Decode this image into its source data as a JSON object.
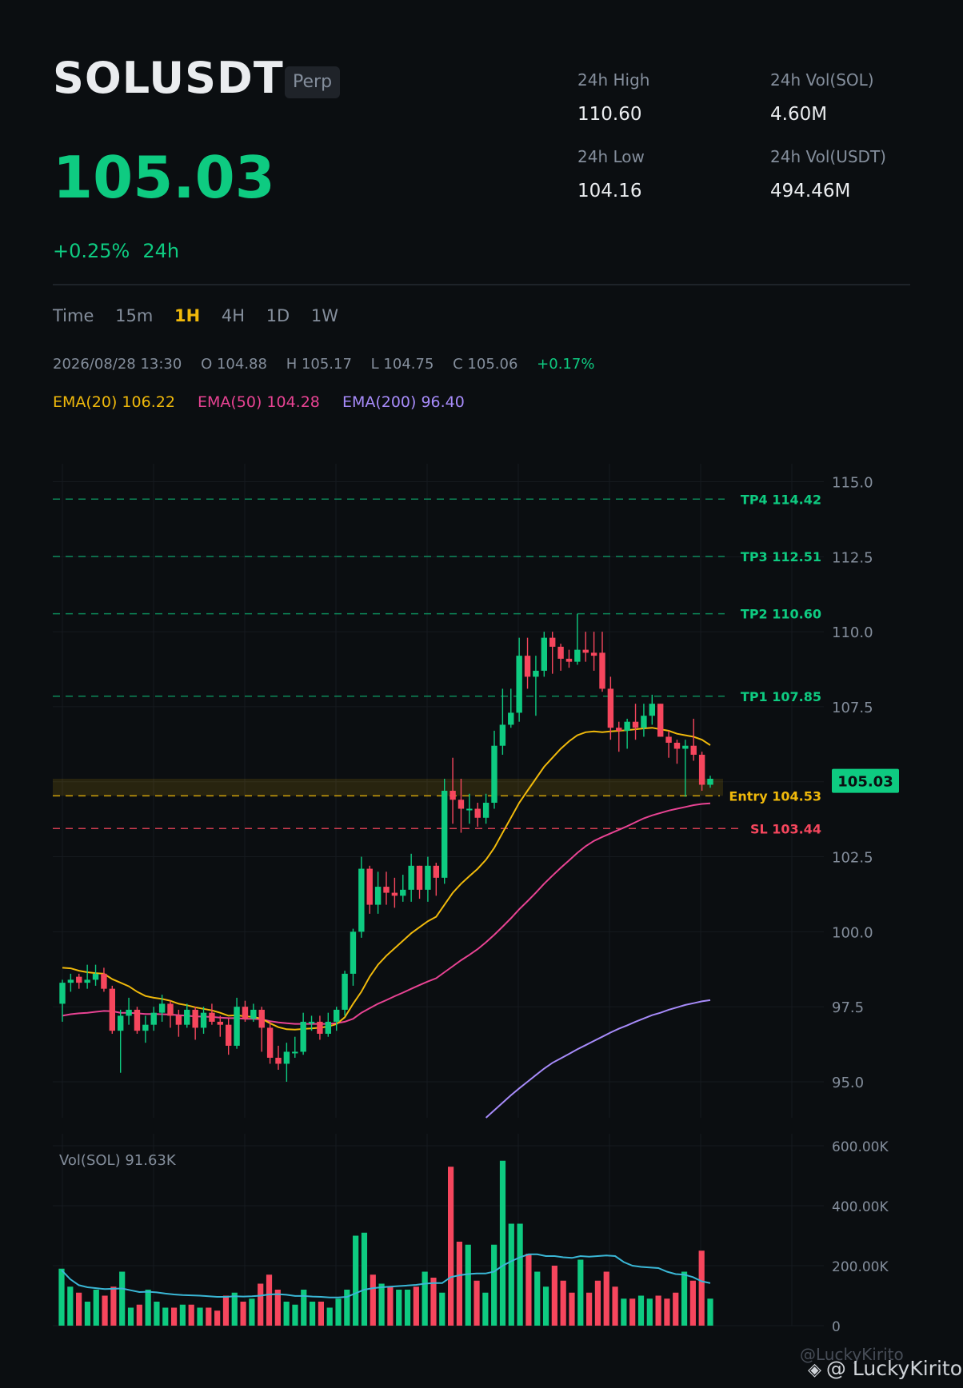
{
  "header": {
    "symbol": "SOLUSDT",
    "badge": "Perp",
    "price": "105.03",
    "change_pct": "+0.25%",
    "change_period": "24h"
  },
  "stats": {
    "high_label": "24h High",
    "high_value": "110.60",
    "low_label": "24h Low",
    "low_value": "104.16",
    "vol_base_label": "24h Vol(SOL)",
    "vol_base_value": "4.60M",
    "vol_quote_label": "24h Vol(USDT)",
    "vol_quote_value": "494.46M"
  },
  "timeframes": {
    "label": "Time",
    "options": [
      "15m",
      "1H",
      "4H",
      "1D",
      "1W"
    ],
    "selected": "1H"
  },
  "ohlc": {
    "datetime": "2026/08/28 13:30",
    "open": "O 104.88",
    "high": "H 105.17",
    "low": "L 104.75",
    "close": "C 105.06",
    "change": "+0.17%"
  },
  "indicators": {
    "ema20": "EMA(20) 106.22",
    "ema50": "EMA(50) 104.28",
    "ema200": "EMA(200) 96.40"
  },
  "colors": {
    "up": "#0ecb81",
    "down": "#f6465d",
    "ema20": "#f0b90b",
    "ema50": "#e84393",
    "ema200": "#a78bfa",
    "vol_ma": "#3ab7d6",
    "entry": "#f0b90b",
    "sl": "#f6465d",
    "tp": "#0ecb81"
  },
  "chart_data": {
    "type": "candlestick",
    "price_axis": {
      "ylim": [
        93.8,
        115.6
      ],
      "ticks": [
        "115.0",
        "112.5",
        "110.0",
        "107.5",
        "105.0",
        "102.5",
        "100.0",
        "97.5",
        "95.0"
      ],
      "tick_values": [
        115,
        112.5,
        110,
        107.5,
        105,
        102.5,
        100,
        97.5,
        95
      ]
    },
    "current_price_label": "105.03",
    "current_price": 105.03,
    "levels": [
      {
        "label": "TP4 114.42",
        "value": 114.42,
        "kind": "tp"
      },
      {
        "label": "TP3 112.51",
        "value": 112.51,
        "kind": "tp"
      },
      {
        "label": "TP2 110.60",
        "value": 110.6,
        "kind": "tp"
      },
      {
        "label": "TP1 107.85",
        "value": 107.85,
        "kind": "tp"
      },
      {
        "label": "Entry 104.53",
        "value": 104.53,
        "kind": "entry"
      },
      {
        "label": "SL 103.44",
        "value": 103.44,
        "kind": "sl"
      }
    ],
    "entry_zone": [
      104.53,
      105.1
    ],
    "candles": [
      [
        97.6,
        98.3,
        97.0,
        98.4
      ],
      [
        98.3,
        98.4,
        98.0,
        98.6
      ],
      [
        98.5,
        98.3,
        98.1,
        98.6
      ],
      [
        98.3,
        98.4,
        98.1,
        98.9
      ],
      [
        98.4,
        98.6,
        98.2,
        98.9
      ],
      [
        98.6,
        98.1,
        98.0,
        98.8
      ],
      [
        98.1,
        96.7,
        96.6,
        98.2
      ],
      [
        96.7,
        97.2,
        95.3,
        97.4
      ],
      [
        97.2,
        97.4,
        96.9,
        97.8
      ],
      [
        97.4,
        96.7,
        96.6,
        97.5
      ],
      [
        96.7,
        96.9,
        96.3,
        97.2
      ],
      [
        96.9,
        97.3,
        96.7,
        97.5
      ],
      [
        97.3,
        97.6,
        97.0,
        97.9
      ],
      [
        97.6,
        97.2,
        96.8,
        97.7
      ],
      [
        97.2,
        96.9,
        96.5,
        97.4
      ],
      [
        96.9,
        97.4,
        96.8,
        97.6
      ],
      [
        97.4,
        96.8,
        96.4,
        97.5
      ],
      [
        96.8,
        97.3,
        96.6,
        97.5
      ],
      [
        97.3,
        97.0,
        96.9,
        97.6
      ],
      [
        97.0,
        96.9,
        96.5,
        97.2
      ],
      [
        96.9,
        96.2,
        95.9,
        97.1
      ],
      [
        96.2,
        97.5,
        96.1,
        97.8
      ],
      [
        97.5,
        97.1,
        97.0,
        97.7
      ],
      [
        97.1,
        97.4,
        97.0,
        97.6
      ],
      [
        97.4,
        96.8,
        96.0,
        97.5
      ],
      [
        96.8,
        95.8,
        95.6,
        97.0
      ],
      [
        95.8,
        95.6,
        95.4,
        96.2
      ],
      [
        95.6,
        96.0,
        95.0,
        96.3
      ],
      [
        96.0,
        96.0,
        95.8,
        96.5
      ],
      [
        96.0,
        97.0,
        95.9,
        97.3
      ],
      [
        97.0,
        97.0,
        96.7,
        97.2
      ],
      [
        97.0,
        96.6,
        96.4,
        97.2
      ],
      [
        96.6,
        97.0,
        96.5,
        97.3
      ],
      [
        97.0,
        97.4,
        96.7,
        97.5
      ],
      [
        97.4,
        98.6,
        97.2,
        98.7
      ],
      [
        98.6,
        100.0,
        98.2,
        100.1
      ],
      [
        100.0,
        102.1,
        99.8,
        102.5
      ],
      [
        102.1,
        100.9,
        100.6,
        102.2
      ],
      [
        100.9,
        101.5,
        100.6,
        102.0
      ],
      [
        101.5,
        101.3,
        100.9,
        102.0
      ],
      [
        101.3,
        101.2,
        100.8,
        101.8
      ],
      [
        101.2,
        101.4,
        101.0,
        101.9
      ],
      [
        101.4,
        102.2,
        101.0,
        102.6
      ],
      [
        102.2,
        101.4,
        101.1,
        102.2
      ],
      [
        101.4,
        102.2,
        101.0,
        102.5
      ],
      [
        102.2,
        101.8,
        101.2,
        102.3
      ],
      [
        101.8,
        104.7,
        101.6,
        105.1
      ],
      [
        104.7,
        104.4,
        103.6,
        105.8
      ],
      [
        104.4,
        104.1,
        103.3,
        105.1
      ],
      [
        104.1,
        104.1,
        103.6,
        104.6
      ],
      [
        104.1,
        103.8,
        103.5,
        104.3
      ],
      [
        103.8,
        104.3,
        103.6,
        104.6
      ],
      [
        104.3,
        106.2,
        104.1,
        106.7
      ],
      [
        106.2,
        106.9,
        105.9,
        108.1
      ],
      [
        106.9,
        107.3,
        106.8,
        108.1
      ],
      [
        107.3,
        109.2,
        107.0,
        109.8
      ],
      [
        109.2,
        108.5,
        108.1,
        109.8
      ],
      [
        108.5,
        108.7,
        107.2,
        109.2
      ],
      [
        108.7,
        109.8,
        108.5,
        110.0
      ],
      [
        109.8,
        109.5,
        108.6,
        110.0
      ],
      [
        109.5,
        109.1,
        108.7,
        109.6
      ],
      [
        109.1,
        109.0,
        108.8,
        109.4
      ],
      [
        109.0,
        109.4,
        108.9,
        110.6
      ],
      [
        109.4,
        109.3,
        109.0,
        110.0
      ],
      [
        109.3,
        109.2,
        108.7,
        110.0
      ],
      [
        109.3,
        108.1,
        108.0,
        110.0
      ],
      [
        108.1,
        106.8,
        106.4,
        108.5
      ],
      [
        106.8,
        106.7,
        106.0,
        107.0
      ],
      [
        106.7,
        107.0,
        106.1,
        107.1
      ],
      [
        107.0,
        106.8,
        106.4,
        107.6
      ],
      [
        106.8,
        107.2,
        106.5,
        107.6
      ],
      [
        107.2,
        107.6,
        106.9,
        107.9
      ],
      [
        107.6,
        106.5,
        106.5,
        107.6
      ],
      [
        106.5,
        106.3,
        105.8,
        106.7
      ],
      [
        106.3,
        106.1,
        105.6,
        106.4
      ],
      [
        106.1,
        106.2,
        104.5,
        106.4
      ],
      [
        106.2,
        105.9,
        105.7,
        107.1
      ],
      [
        105.9,
        104.9,
        104.7,
        106.0
      ],
      [
        104.9,
        105.1,
        104.8,
        105.2
      ]
    ],
    "ema20": [
      98.8,
      98.78,
      98.7,
      98.65,
      98.62,
      98.6,
      98.42,
      98.3,
      98.18,
      98.0,
      97.86,
      97.8,
      97.76,
      97.7,
      97.6,
      97.55,
      97.48,
      97.43,
      97.38,
      97.3,
      97.2,
      97.22,
      97.18,
      97.16,
      97.1,
      96.95,
      96.82,
      96.75,
      96.74,
      96.76,
      96.78,
      96.8,
      96.84,
      96.92,
      97.15,
      97.6,
      98.0,
      98.5,
      98.9,
      99.2,
      99.45,
      99.7,
      99.95,
      100.15,
      100.35,
      100.5,
      100.9,
      101.3,
      101.6,
      101.85,
      102.1,
      102.4,
      102.8,
      103.3,
      103.8,
      104.3,
      104.7,
      105.1,
      105.5,
      105.8,
      106.1,
      106.35,
      106.55,
      106.65,
      106.68,
      106.65,
      106.68,
      106.7,
      106.72,
      106.75,
      106.78,
      106.8,
      106.75,
      106.7,
      106.6,
      106.55,
      106.5,
      106.4,
      106.22
    ],
    "ema50": [
      97.2,
      97.25,
      97.28,
      97.3,
      97.33,
      97.36,
      97.35,
      97.3,
      97.3,
      97.28,
      97.26,
      97.26,
      97.25,
      97.24,
      97.22,
      97.2,
      97.18,
      97.17,
      97.16,
      97.14,
      97.12,
      97.12,
      97.1,
      97.1,
      97.08,
      97.02,
      96.98,
      96.95,
      96.93,
      96.93,
      96.93,
      96.93,
      96.93,
      96.95,
      97.0,
      97.1,
      97.3,
      97.45,
      97.6,
      97.72,
      97.85,
      97.97,
      98.1,
      98.22,
      98.34,
      98.45,
      98.65,
      98.85,
      99.05,
      99.23,
      99.42,
      99.65,
      99.9,
      100.17,
      100.45,
      100.75,
      101.02,
      101.3,
      101.6,
      101.87,
      102.13,
      102.38,
      102.63,
      102.85,
      103.03,
      103.16,
      103.28,
      103.4,
      103.52,
      103.65,
      103.78,
      103.88,
      103.96,
      104.04,
      104.1,
      104.16,
      104.22,
      104.26,
      104.28
    ],
    "ema200_start_index": 51,
    "ema200": [
      93.8,
      94.05,
      94.3,
      94.55,
      94.78,
      95.0,
      95.22,
      95.44,
      95.63,
      95.78,
      95.93,
      96.08,
      96.22,
      96.36,
      96.5,
      96.64,
      96.77,
      96.88,
      97.0,
      97.11,
      97.22,
      97.3,
      97.4,
      97.48,
      97.56,
      97.62,
      97.68,
      97.72
    ],
    "volume": {
      "label": "Vol(SOL) 91.63K",
      "ylim": [
        0,
        640000
      ],
      "ticks": [
        "600.00K",
        "400.00K",
        "200.00K",
        "0"
      ],
      "tick_values": [
        600000,
        400000,
        200000,
        0
      ],
      "values": [
        190000,
        130000,
        110000,
        80000,
        120000,
        100000,
        130000,
        180000,
        60000,
        70000,
        120000,
        80000,
        60000,
        60000,
        70000,
        70000,
        60000,
        60000,
        50000,
        100000,
        110000,
        80000,
        90000,
        140000,
        170000,
        120000,
        80000,
        70000,
        120000,
        80000,
        80000,
        60000,
        90000,
        120000,
        300000,
        310000,
        170000,
        140000,
        130000,
        120000,
        120000,
        130000,
        180000,
        160000,
        110000,
        530000,
        280000,
        270000,
        150000,
        110000,
        270000,
        550000,
        340000,
        340000,
        240000,
        180000,
        130000,
        200000,
        150000,
        110000,
        220000,
        110000,
        150000,
        180000,
        130000,
        90000,
        90000,
        100000,
        90000,
        100000,
        90000,
        110000,
        180000,
        150000,
        250000,
        90000
      ],
      "ma": [
        185000,
        155000,
        135000,
        128000,
        125000,
        122000,
        123000,
        124000,
        118000,
        112000,
        113000,
        111000,
        107000,
        104000,
        102000,
        101000,
        100000,
        98000,
        96000,
        96000,
        98000,
        97000,
        98000,
        100000,
        104000,
        105000,
        103000,
        99000,
        99000,
        97000,
        96000,
        94000,
        94000,
        96000,
        108000,
        120000,
        125000,
        128000,
        130000,
        132000,
        134000,
        136000,
        140000,
        142000,
        142000,
        162000,
        168000,
        172000,
        174000,
        174000,
        180000,
        200000,
        215000,
        228000,
        238000,
        238000,
        232000,
        232000,
        228000,
        226000,
        232000,
        230000,
        232000,
        234000,
        232000,
        212000,
        200000,
        196000,
        194000,
        192000,
        180000,
        172000,
        170000,
        162000,
        148000,
        142000
      ]
    }
  },
  "watermark": {
    "faded": "@LuckyKirito",
    "handle": "@ LuckyKirito",
    "logo": "binance-logo-icon"
  }
}
